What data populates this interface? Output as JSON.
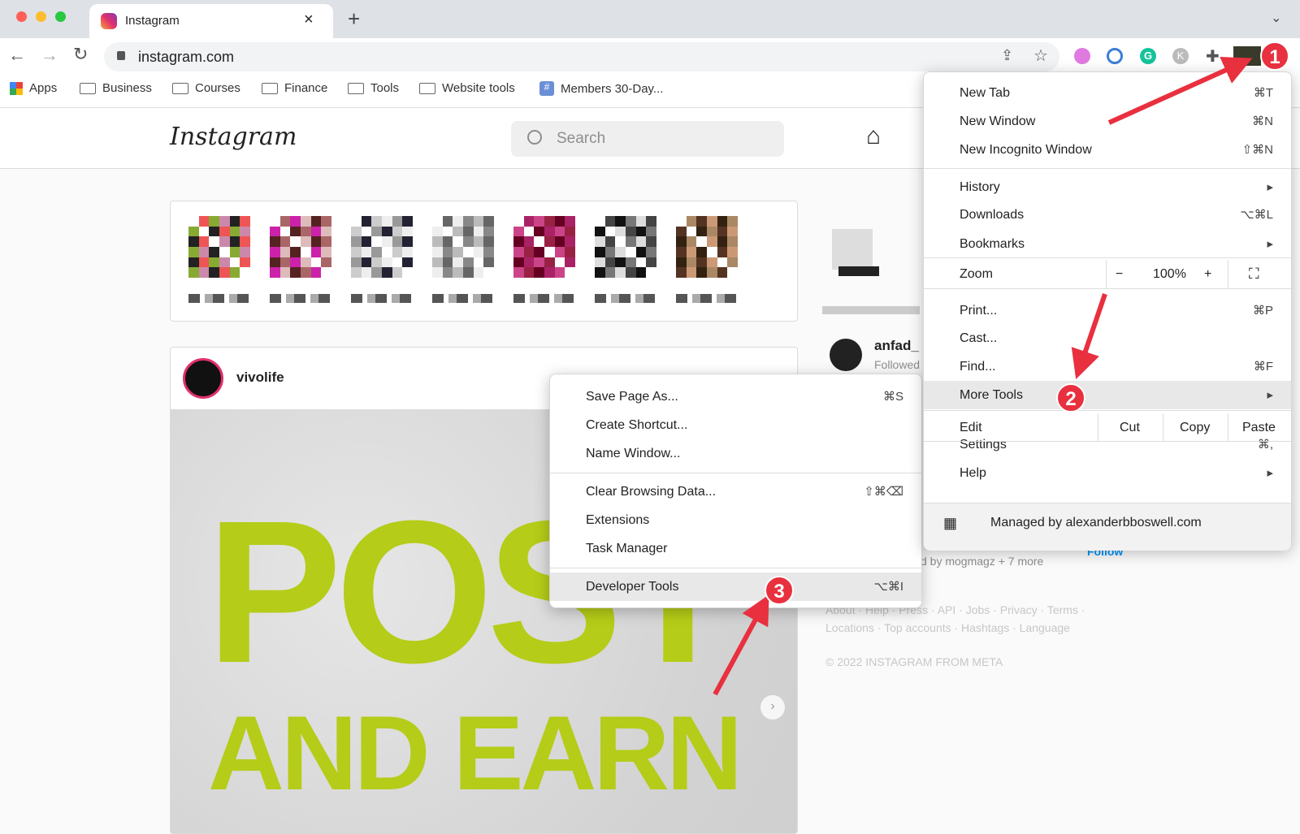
{
  "browser": {
    "tab_title": "Instagram",
    "url": "instagram.com",
    "bookmarks": [
      "Apps",
      "Business",
      "Courses",
      "Finance",
      "Tools",
      "Website tools",
      "Members 30-Day..."
    ]
  },
  "instagram": {
    "logo": "Instagram",
    "search_placeholder": "Search",
    "post_user": "vivolife",
    "post_text_line1": "POST",
    "post_text_line2": "AND EARN",
    "suggestion_user": "anfad_",
    "suggestion_sub": "Followed",
    "followed_by": "d by mogmagz + 7 more",
    "follow_label": "Follow",
    "footer_line1": "About · Help · Press · API · Jobs · Privacy · Terms ·",
    "footer_line2": "Locations · Top accounts · Hashtags · Language",
    "copyright": "© 2022 INSTAGRAM FROM META"
  },
  "chrome_menu": {
    "items": [
      {
        "label": "New Tab",
        "shortcut": "⌘T"
      },
      {
        "label": "New Window",
        "shortcut": "⌘N"
      },
      {
        "label": "New Incognito Window",
        "shortcut": "⇧⌘N"
      },
      {
        "label": "History",
        "shortcut": "▸"
      },
      {
        "label": "Downloads",
        "shortcut": "⌥⌘L"
      },
      {
        "label": "Bookmarks",
        "shortcut": "▸"
      },
      {
        "label": "Print...",
        "shortcut": "⌘P"
      },
      {
        "label": "Cast...",
        "shortcut": ""
      },
      {
        "label": "Find...",
        "shortcut": "⌘F"
      },
      {
        "label": "More Tools",
        "shortcut": "▸"
      },
      {
        "label": "Settings",
        "shortcut": "⌘,"
      },
      {
        "label": "Help",
        "shortcut": "▸"
      }
    ],
    "zoom": {
      "label": "Zoom",
      "minus": "−",
      "value": "100%",
      "plus": "+"
    },
    "edit": {
      "label": "Edit",
      "cut": "Cut",
      "copy": "Copy",
      "paste": "Paste"
    },
    "managed": "Managed by alexanderbboswell.com"
  },
  "more_tools_menu": {
    "items": [
      {
        "label": "Save Page As...",
        "shortcut": "⌘S"
      },
      {
        "label": "Create Shortcut...",
        "shortcut": ""
      },
      {
        "label": "Name Window...",
        "shortcut": ""
      },
      {
        "label": "Clear Browsing Data...",
        "shortcut": "⇧⌘⌫"
      },
      {
        "label": "Extensions",
        "shortcut": ""
      },
      {
        "label": "Task Manager",
        "shortcut": ""
      },
      {
        "label": "Developer Tools",
        "shortcut": "⌥⌘I"
      }
    ]
  },
  "annotations": {
    "step1": "1",
    "step2": "2",
    "step3": "3",
    "color": "#e8303f"
  }
}
